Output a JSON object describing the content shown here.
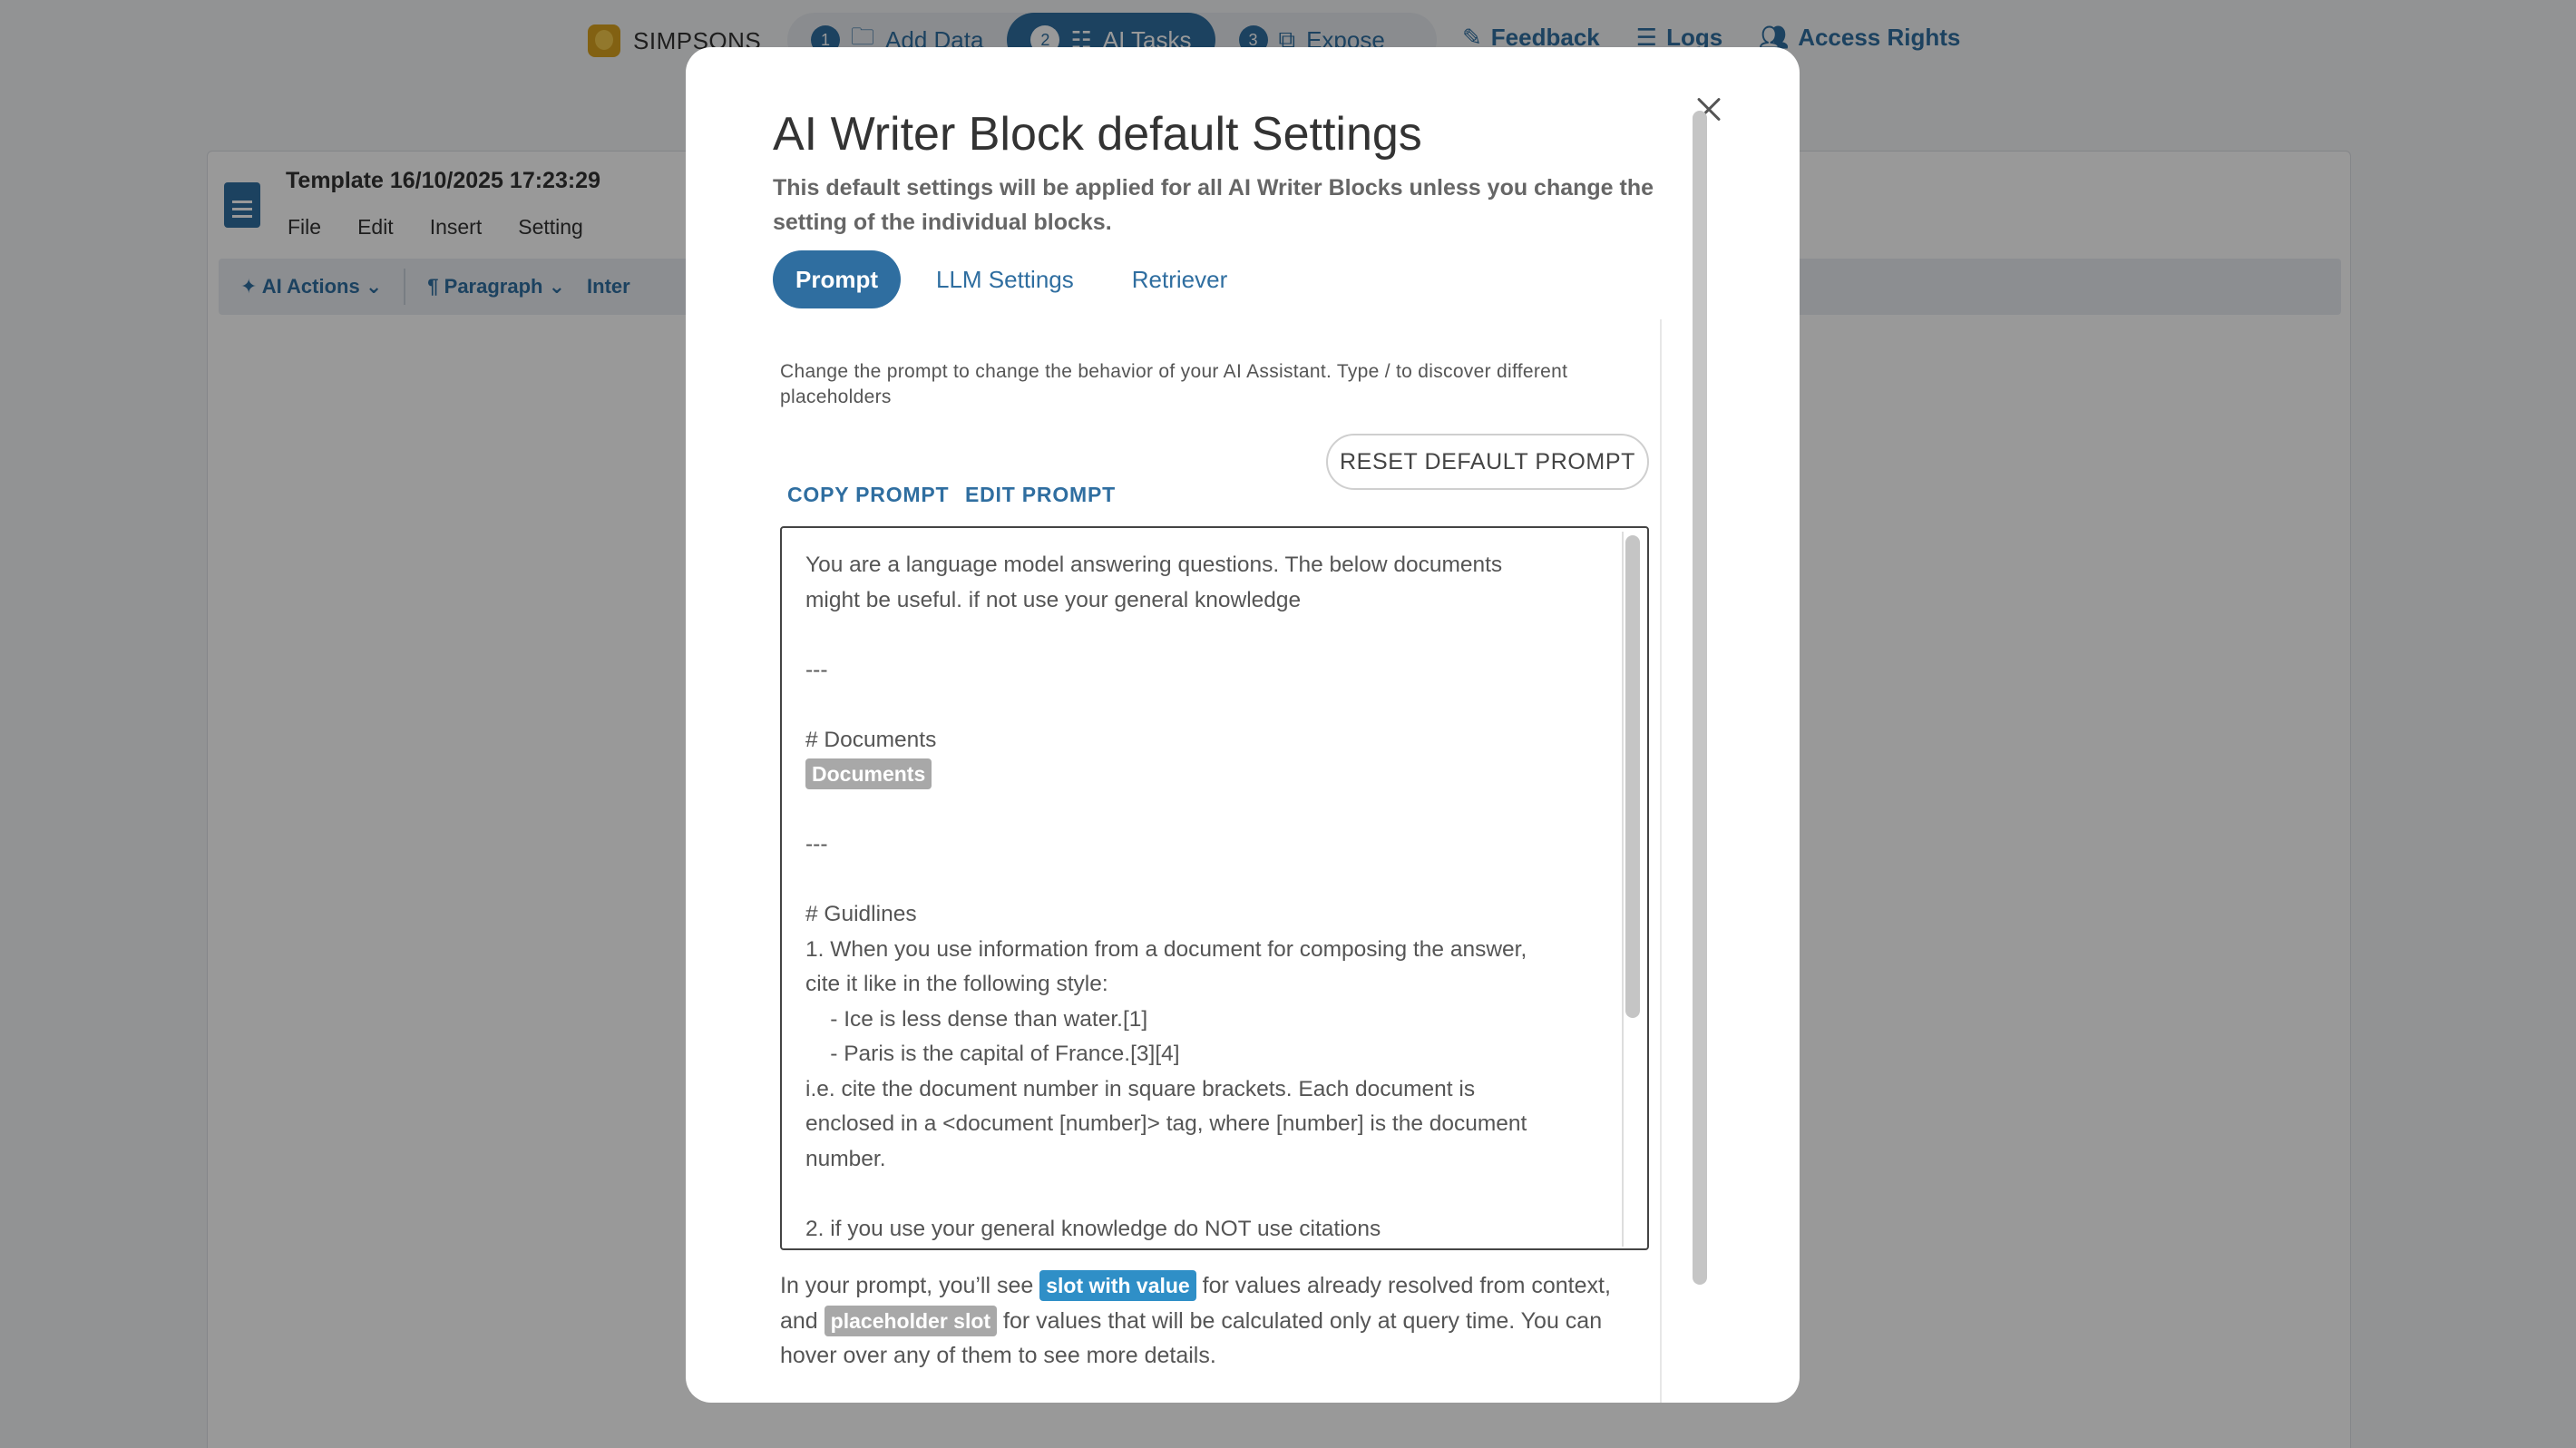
{
  "topbar": {
    "brand": "SIMPSONS",
    "steps": [
      {
        "num": "1",
        "label": "Add Data",
        "icon": "folder-icon",
        "active": false
      },
      {
        "num": "2",
        "label": "AI Tasks",
        "icon": "tasks-icon",
        "active": true
      },
      {
        "num": "3",
        "label": "Expose",
        "icon": "expose-icon",
        "active": false
      }
    ],
    "links": [
      {
        "label": "Feedback",
        "icon": "feedback-icon"
      },
      {
        "label": "Logs",
        "icon": "logs-icon"
      },
      {
        "label": "Access Rights",
        "icon": "users-icon"
      }
    ]
  },
  "document": {
    "title": "Template 16/10/2025 17:23:29",
    "menu": [
      "File",
      "Edit",
      "Insert",
      "Setting"
    ],
    "toolbar": {
      "ai_actions": "AI Actions",
      "paragraph": "Paragraph",
      "truncated": "Inter"
    }
  },
  "modal": {
    "title": "AI Writer Block default Settings",
    "subtitle": "This default settings will be applied for all AI Writer Blocks unless you change the setting of the individual blocks.",
    "tabs": [
      {
        "label": "Prompt",
        "active": true
      },
      {
        "label": "LLM Settings",
        "active": false
      },
      {
        "label": "Retriever",
        "active": false
      }
    ],
    "hint": "Change the prompt to change the behavior of your AI Assistant. Type / to discover different placeholders",
    "copy_prompt": "COPY PROMPT",
    "edit_prompt": "EDIT PROMPT",
    "reset_prompt": "RESET DEFAULT PROMPT",
    "prompt": {
      "line1": "You are a language model answering questions. The below documents",
      "line2": "might be useful. if not use your general knowledge",
      "sep1": "---",
      "documents_heading": "# Documents",
      "documents_slot": "Documents",
      "sep2": "---",
      "guidelines_heading": "# Guidlines",
      "g1a": "1. When you use information from a document for composing the answer,",
      "g1b": "cite it like in the following style:",
      "g1c": "    - Ice is less dense than water.[1]",
      "g1d": "    - Paris is the capital of France.[3][4]",
      "g1e": "i.e. cite the document number in square brackets. Each document is",
      "g1f": "enclosed in a <document [number]> tag, where [number] is the document",
      "g1g": "number.",
      "g2": "2. if you use your general knowledge do NOT use citations"
    },
    "footnote": {
      "part1": "In your prompt, you’ll see ",
      "slot_with_value": "slot with value",
      "part2": " for values already resolved from context, and ",
      "placeholder_slot": "placeholder slot",
      "part3": " for values that will be calculated only at query time. You can hover over any of them to see more details."
    }
  }
}
